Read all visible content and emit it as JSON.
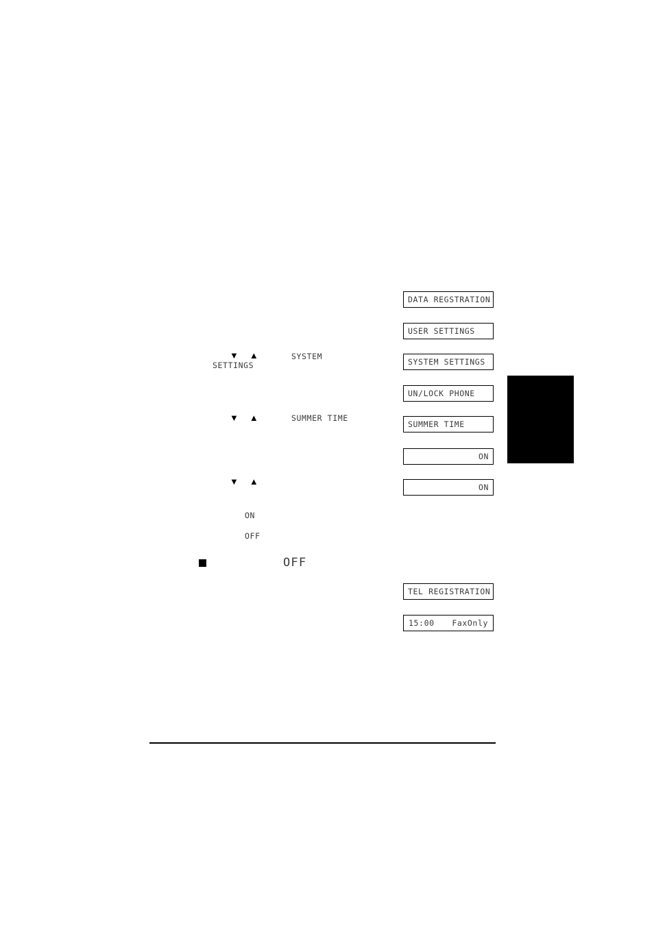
{
  "document": {
    "type": "fax-machine-manual-page",
    "lcd_display_sequence": [
      {
        "id": "data-registration",
        "text": "DATA REGSTRATION",
        "align": "left"
      },
      {
        "id": "user-settings",
        "text": "USER SETTINGS",
        "align": "left"
      },
      {
        "id": "system-settings",
        "text": "SYSTEM SETTINGS",
        "align": "left"
      },
      {
        "id": "unlock-phone",
        "text": "UN/LOCK PHONE",
        "align": "left"
      },
      {
        "id": "summer-time",
        "text": "SUMMER TIME",
        "align": "left"
      },
      {
        "id": "summer-time-value-1",
        "text": "ON",
        "align": "right"
      },
      {
        "id": "summer-time-value-2",
        "text": "ON",
        "align": "right"
      },
      {
        "id": "tel-registration",
        "text": "TEL REGISTRATION",
        "align": "left"
      },
      {
        "id": "standby-display",
        "left_text": "15:00",
        "right_text": "FaxOnly",
        "align": "split"
      }
    ],
    "steps": [
      {
        "id": "step-system-settings",
        "down_arrow": "▼",
        "up_arrow": "▲",
        "label_line_1": "SYSTEM",
        "label_line_2": "SETTINGS"
      },
      {
        "id": "step-summer-time",
        "down_arrow": "▼",
        "up_arrow": "▲",
        "label_line_1": "SUMMER TIME",
        "label_line_2": ""
      },
      {
        "id": "step-select-value",
        "down_arrow": "▼",
        "up_arrow": "▲",
        "label_line_1": "",
        "label_line_2": ""
      }
    ],
    "option_list": [
      {
        "id": "option-on",
        "text": "ON"
      },
      {
        "id": "option-off",
        "text": "OFF"
      }
    ],
    "note": {
      "id": "note-off",
      "bullet": "■",
      "text": "OFF"
    }
  }
}
